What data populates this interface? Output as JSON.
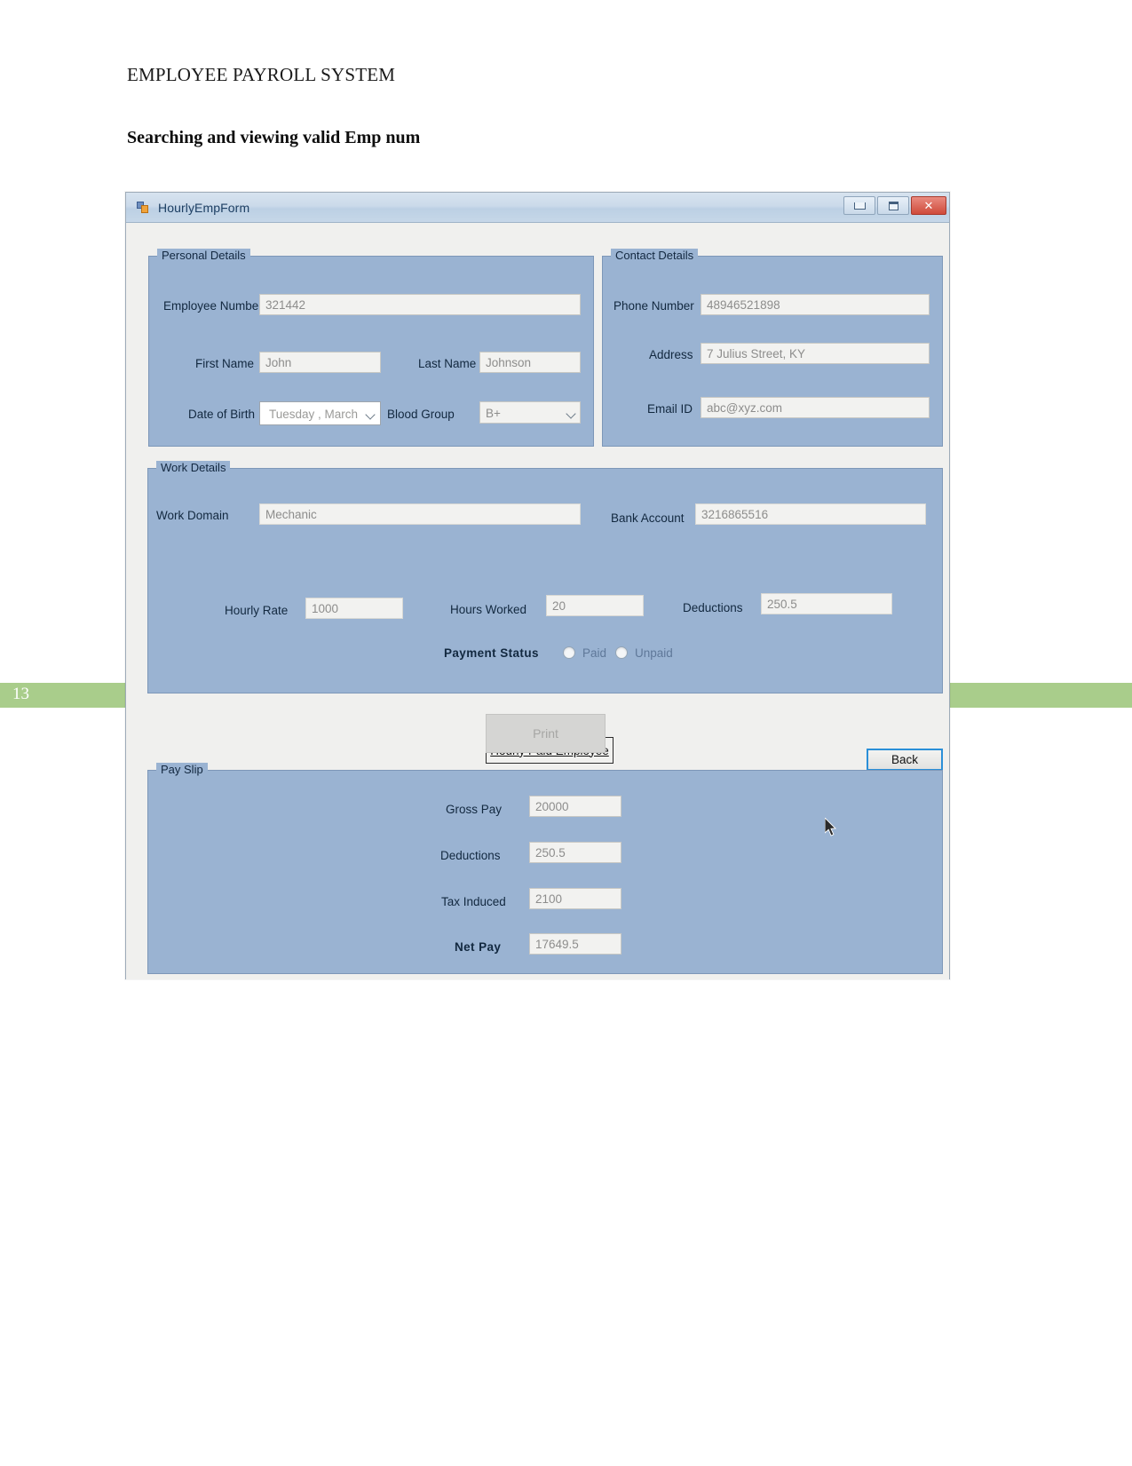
{
  "document": {
    "header_title": "EMPLOYEE PAYROLL SYSTEM",
    "section_heading": "Searching and viewing valid Emp num",
    "page_number": "13",
    "accent_green": "#a9cd8b"
  },
  "window": {
    "title": "HourlyEmpForm",
    "icon": "form-icon",
    "controls": {
      "minimize": "minimize-icon",
      "maximize": "maximize-icon",
      "close": "✕"
    },
    "colors": {
      "panel": "#9ab3d2",
      "client": "#f0f0ee",
      "titlebar": "#c8d9ea",
      "close_button": "#cf4a3a",
      "focus_border": "#2a8fd8"
    }
  },
  "personal_details": {
    "group_label": "Personal Details",
    "fields": [
      {
        "label": "Employee Number",
        "value": "321442"
      },
      {
        "label": "First Name",
        "value": "John"
      },
      {
        "label": "Last Name",
        "value": "Johnson"
      },
      {
        "label": "Date of Birth",
        "value": "Tuesday  ,  March"
      },
      {
        "label": "Blood Group",
        "value": "B+"
      }
    ]
  },
  "contact_details": {
    "group_label": "Contact Details",
    "fields": [
      {
        "label": "Phone Number",
        "value": "48946521898"
      },
      {
        "label": "Address",
        "value": "7 Julius Street, KY"
      },
      {
        "label": "Email ID",
        "value": "abc@xyz.com"
      }
    ]
  },
  "work_details": {
    "group_label": "Work Details",
    "fields": [
      {
        "label": "Work Domain",
        "value": "Mechanic"
      },
      {
        "label": "Bank Account",
        "value": "3216865516"
      },
      {
        "label": "Hourly Rate",
        "value": "1000"
      },
      {
        "label": "Hours Worked",
        "value": "20"
      },
      {
        "label": "Deductions",
        "value": "250.5"
      }
    ],
    "employee_type_button": "Hourly Paid Employee",
    "payment_status": {
      "label": "Payment Status",
      "options": [
        {
          "label": "Paid",
          "selected": false
        },
        {
          "label": "Unpaid",
          "selected": false
        }
      ]
    }
  },
  "actions": {
    "print_label": "Print",
    "print_enabled": false,
    "back_label": "Back"
  },
  "pay_slip": {
    "group_label": "Pay Slip",
    "rows": [
      {
        "label": "Gross Pay",
        "value": "20000",
        "bold": false
      },
      {
        "label": "Deductions",
        "value": "250.5",
        "bold": false
      },
      {
        "label": "Tax Induced",
        "value": "2100",
        "bold": false
      },
      {
        "label": "Net Pay",
        "value": "17649.5",
        "bold": true
      }
    ]
  }
}
